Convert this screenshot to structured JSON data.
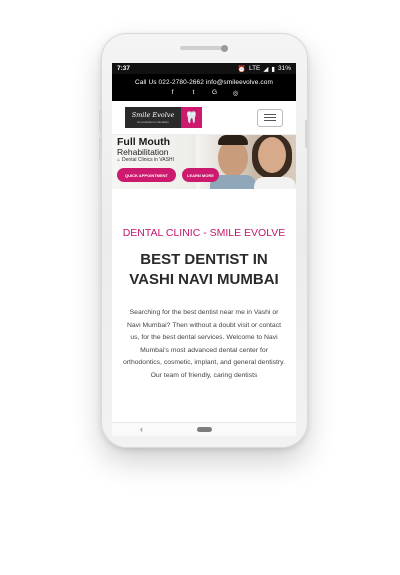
{
  "status_bar": {
    "time": "7:37",
    "alarm_icon": "alarm-icon",
    "network": "LTE",
    "signal_icon": "signal-icon",
    "battery": "31%"
  },
  "contact": {
    "line": "Call Us 022-2780-2662   info@smileevolve.com",
    "social": [
      "f",
      "t",
      "G",
      "◎"
    ]
  },
  "nav": {
    "logo_name": "Smile Evolve",
    "logo_tag": "An evolution in dentistry",
    "menu_icon": "hamburger-menu-icon"
  },
  "banner": {
    "title": "Full Mouth",
    "subtitle": "Rehabilitation",
    "note": "Dental Clinics in VASHI",
    "quick_button": "QUICK APPOINTMENT",
    "learn_button": "LEARN MORE"
  },
  "main": {
    "subtitle": "DENTAL CLINIC - SMILE EVOLVE",
    "heading": "BEST DENTIST IN VASHI NAVI MUMBAI",
    "paragraph": "Searching for the best dentist near me in Vashi or Navi Mumbai? Then without a doubt visit or contact us, for the best dental services. Welcome to Navi Mumbai's most advanced dental center for orthodontics, cosmetic, implant, and general dentistry. Our team of friendly, caring dentists"
  },
  "colors": {
    "accent": "#cc1b6e",
    "header_bg": "#000000"
  }
}
